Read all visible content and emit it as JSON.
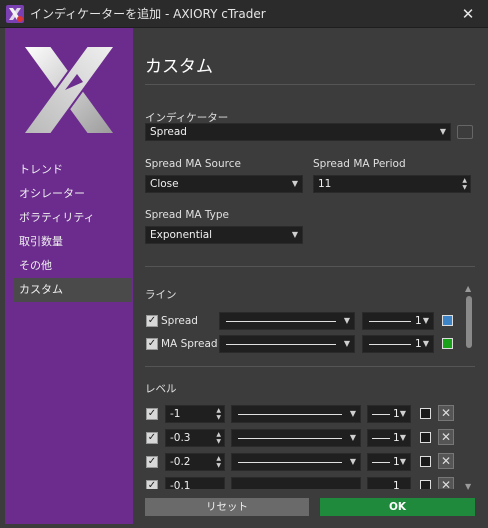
{
  "window": {
    "title": "インディケーターを追加 - AXIORY cTrader",
    "close_glyph": "✕"
  },
  "sidebar": {
    "items": [
      {
        "label": "トレンド"
      },
      {
        "label": "オシレーター"
      },
      {
        "label": "ボラティリティ"
      },
      {
        "label": "取引数量"
      },
      {
        "label": "その他"
      },
      {
        "label": "カスタム"
      }
    ],
    "active": "カスタム"
  },
  "content": {
    "heading": "カスタム",
    "indicator_label": "インディケーター",
    "indicator_value": "Spread",
    "source_label": "Spread MA Source",
    "source_value": "Close",
    "period_label": "Spread MA Period",
    "period_value": "11",
    "type_label": "Spread MA Type",
    "type_value": "Exponential"
  },
  "lines": {
    "section_label": "ライン",
    "items": [
      {
        "label": "Spread",
        "checked": true,
        "thickness": "1",
        "color": "#3d84c6"
      },
      {
        "label": "MA Spread",
        "checked": true,
        "thickness": "1",
        "color": "#1aa11a"
      }
    ]
  },
  "levels": {
    "section_label": "レベル",
    "items": [
      {
        "value": "-1",
        "thickness": "1"
      },
      {
        "value": "-0.3",
        "thickness": "1"
      },
      {
        "value": "-0.2",
        "thickness": "1"
      },
      {
        "value": "-0.1",
        "thickness": "1"
      }
    ]
  },
  "footer": {
    "reset_label": "リセット",
    "ok_label": "OK"
  },
  "glyphs": {
    "dropdown": "▼",
    "check": "✓",
    "remove": "✕",
    "spin_up": "▲",
    "spin_down": "▼"
  }
}
